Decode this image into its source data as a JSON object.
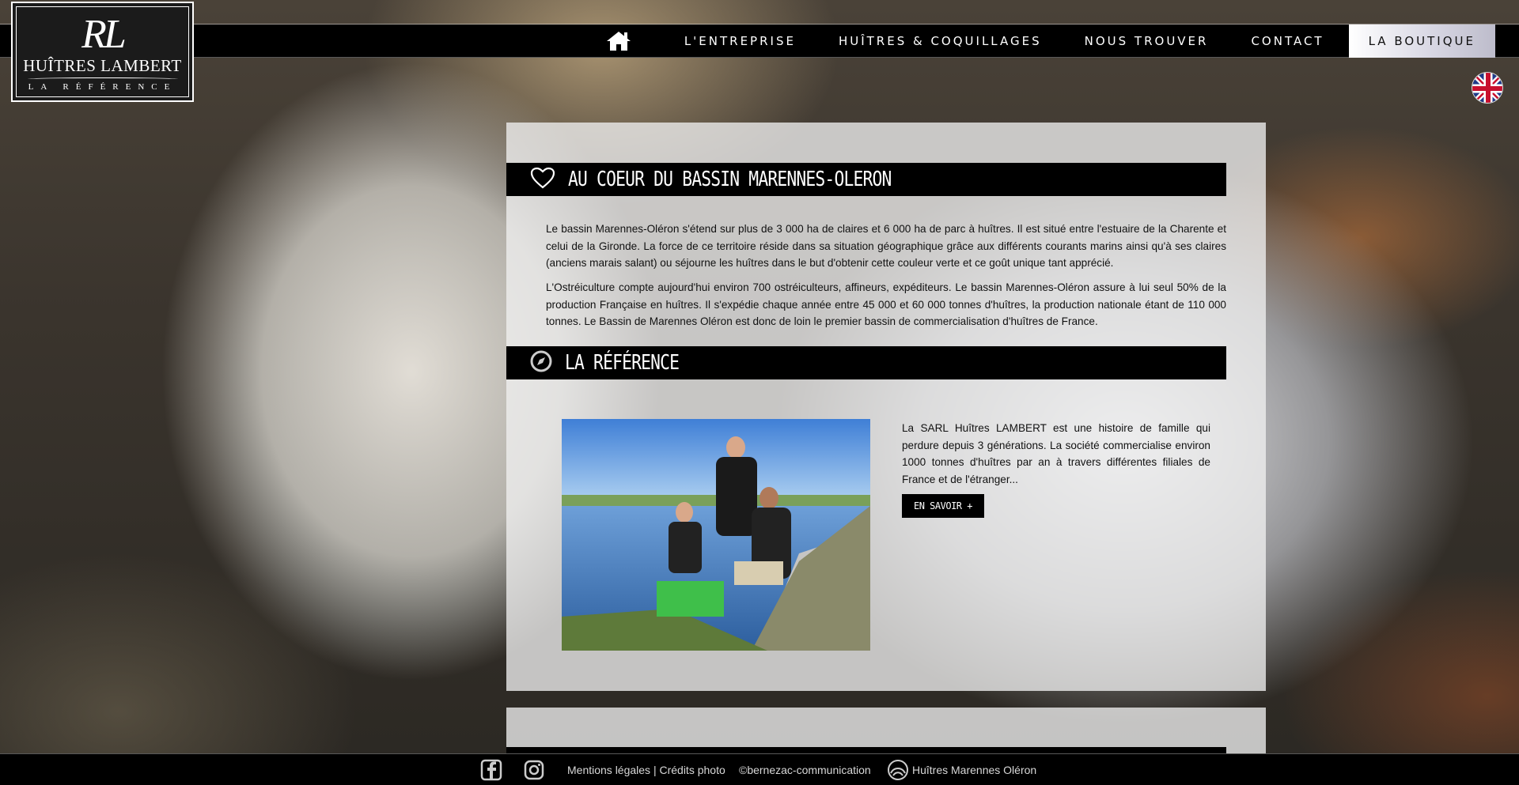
{
  "brand": {
    "monogram": "RL",
    "name": "HUÎTRES LAMBERT",
    "tagline": "LA RÉFÉRENCE"
  },
  "nav": {
    "items": [
      {
        "label": "L'ENTREPRISE"
      },
      {
        "label": "HUÎTRES & COQUILLAGES"
      },
      {
        "label": "NOUS TROUVER"
      },
      {
        "label": "CONTACT"
      },
      {
        "label": "LA BOUTIQUE"
      }
    ],
    "active": "LA BOUTIQUE"
  },
  "section1": {
    "title": "AU COEUR DU BASSIN MARENNES-OLERON",
    "icon": "heart-icon",
    "paragraphs": [
      "Le bassin Marennes-Oléron s'étend sur plus de 3 000 ha de claires et 6 000 ha de parc à huîtres. Il est situé entre l'estuaire de la Charente et celui de la Gironde. La force de ce territoire réside dans sa situation géographique grâce aux différents courants marins ainsi qu'à ses claires (anciens marais salant) ou séjourne les huîtres dans le but d'obtenir cette couleur verte et ce goût unique tant apprécié.",
      "L'Ostréiculture compte aujourd'hui environ 700 ostréiculteurs, affineurs, expéditeurs. Le bassin Marennes-Oléron assure à lui seul 50% de la production Française en huîtres. Il s'expédie chaque année entre 45 000 et 60 000 tonnes d'huîtres, la production nationale étant de 110 000 tonnes. Le Bassin de Marennes Oléron est donc de loin le premier bassin de commercialisation d'huîtres de France."
    ]
  },
  "section2": {
    "title": "LA RÉFÉRENCE",
    "icon": "compass-icon",
    "text": "La SARL Huîtres LAMBERT est une histoire de famille qui perdure depuis 3 générations. La société commercialise environ 1000 tonnes d'huîtres par an à travers différentes filiales de France et de l'étranger...",
    "button": "EN SAVOIR +"
  },
  "footer": {
    "legal": "Mentions légales | Crédits photo",
    "credit": "©bernezac-communication",
    "partner": "Huîtres Marennes Oléron"
  },
  "colors": {
    "bar": "#000000",
    "panel": "rgba(240,240,240,0.78)",
    "active_tab": "#d9d8e4"
  }
}
